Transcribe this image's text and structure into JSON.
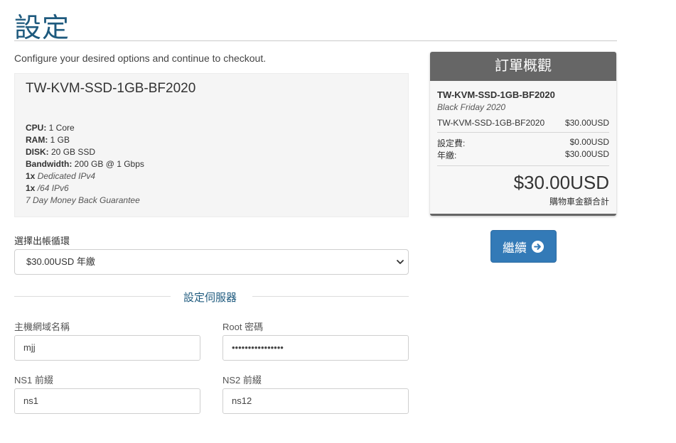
{
  "page": {
    "title": "設定",
    "intro": "Configure your desired options and continue to checkout."
  },
  "product": {
    "name": "TW-KVM-SSD-1GB-BF2020",
    "specs": [
      {
        "key": "CPU:",
        "value": " 1 Core"
      },
      {
        "key": "RAM:",
        "value": " 1 GB"
      },
      {
        "key": "DISK:",
        "value": " 20 GB SSD"
      },
      {
        "key": "Bandwidth:",
        "value": " 200 GB @ 1 Gbps"
      }
    ],
    "extras": [
      {
        "qty": "1x",
        "value": "Dedicated IPv4"
      },
      {
        "qty": "1x",
        "value": "/64 IPv6"
      }
    ],
    "guarantee": "7 Day Money Back Guarantee"
  },
  "billing": {
    "label": "選擇出帳循環",
    "selected": "$30.00USD 年繳"
  },
  "server_config": {
    "heading": "設定伺服器",
    "hostname": {
      "label": "主機網域名稱",
      "value": "mjj"
    },
    "root_password": {
      "label": "Root 密碼",
      "value": "••••••••••••••••"
    },
    "ns1": {
      "label": "NS1 前綴",
      "value": "ns1"
    },
    "ns2": {
      "label": "NS2 前綴",
      "value": "ns12"
    }
  },
  "summary": {
    "title": "訂單概觀",
    "product_name": "TW-KVM-SSD-1GB-BF2020",
    "product_group": "Black Friday 2020",
    "line_item": {
      "label": "TW-KVM-SSD-1GB-BF2020",
      "amount": "$30.00USD"
    },
    "setup_fee": {
      "label": "設定費:",
      "amount": "$0.00USD"
    },
    "recurring": {
      "label": "年繳:",
      "amount": "$30.00USD"
    },
    "total": "$30.00USD",
    "total_label": "購物車金額合計"
  },
  "actions": {
    "continue_label": "繼續",
    "continue_icon": "arrow-circle-right-icon"
  },
  "colors": {
    "title_blue": "#1e5a7e",
    "button_blue": "#337ab7",
    "summary_header": "#666666"
  }
}
